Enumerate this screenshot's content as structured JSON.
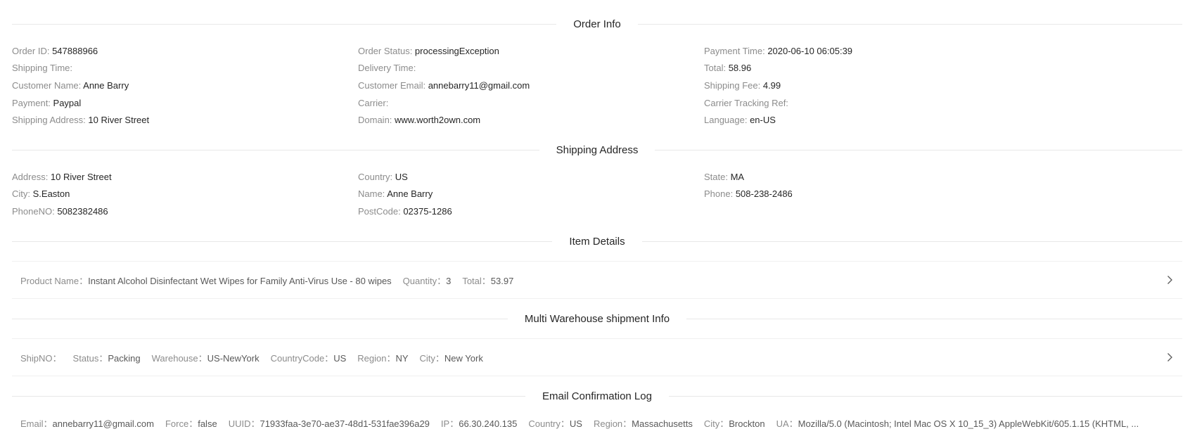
{
  "sections": {
    "order_info": "Order Info",
    "shipping_address": "Shipping Address",
    "item_details": "Item Details",
    "multi_warehouse": "Multi Warehouse shipment Info",
    "email_log": "Email Confirmation Log"
  },
  "order_info": {
    "rows": [
      [
        {
          "label": "Order ID: ",
          "value": "547888966"
        },
        {
          "label": "Order Status: ",
          "value": "processingException"
        },
        {
          "label": "Payment Time: ",
          "value": "2020-06-10 06:05:39"
        }
      ],
      [
        {
          "label": "Shipping Time: ",
          "value": ""
        },
        {
          "label": "Delivery Time: ",
          "value": ""
        },
        {
          "label": "Total: ",
          "value": "58.96"
        }
      ],
      [
        {
          "label": "Customer Name: ",
          "value": "Anne Barry"
        },
        {
          "label": "Customer Email: ",
          "value": "annebarry11@gmail.com"
        },
        {
          "label": "Shipping Fee: ",
          "value": "4.99"
        }
      ],
      [
        {
          "label": "Payment: ",
          "value": "Paypal"
        },
        {
          "label": "Carrier: ",
          "value": ""
        },
        {
          "label": "Carrier Tracking Ref: ",
          "value": ""
        }
      ],
      [
        {
          "label": "Shipping Address: ",
          "value": "10 River Street"
        },
        {
          "label": "Domain: ",
          "value": "www.worth2own.com"
        },
        {
          "label": "Language: ",
          "value": "en-US"
        }
      ]
    ]
  },
  "shipping_address": {
    "rows": [
      [
        {
          "label": "Address: ",
          "value": "10 River Street"
        },
        {
          "label": "Country: ",
          "value": "US"
        },
        {
          "label": "State: ",
          "value": "MA"
        }
      ],
      [
        {
          "label": "City: ",
          "value": "S.Easton"
        },
        {
          "label": "Name: ",
          "value": "Anne Barry"
        },
        {
          "label": "Phone: ",
          "value": "508-238-2486"
        }
      ],
      [
        {
          "label": "PhoneNO: ",
          "value": "5082382486"
        },
        {
          "label": "PostCode: ",
          "value": "02375-1286"
        },
        {
          "label": "",
          "value": ""
        }
      ]
    ]
  },
  "item_details": {
    "product_name_label": "Product Name：",
    "product_name": "Instant Alcohol Disinfectant Wet Wipes for Family Anti-Virus Use - 80 wipes",
    "quantity_label": "Quantity：",
    "quantity": "3",
    "total_label": "Total：",
    "total": "53.97"
  },
  "multi_warehouse": {
    "shipno_label": "ShipNO：",
    "shipno": "",
    "status_label": "Status：",
    "status": "Packing",
    "warehouse_label": "Warehouse：",
    "warehouse": "US-NewYork",
    "countrycode_label": "CountryCode：",
    "countrycode": "US",
    "region_label": "Region：",
    "region": "NY",
    "city_label": "City：",
    "city": "New York"
  },
  "email_log": {
    "email_label": "Email：",
    "email": "annebarry11@gmail.com",
    "force_label": "Force：",
    "force": "false",
    "uuid_label": "UUID：",
    "uuid": "71933faa-3e70-ae37-48d1-531fae396a29",
    "ip_label": "IP：",
    "ip": "66.30.240.135",
    "country_label": "Country：",
    "country": "US",
    "region_label": "Region：",
    "region": "Massachusetts",
    "city_label": "City：",
    "city": "Brockton",
    "ua_label": "UA：",
    "ua": "Mozilla/5.0 (Macintosh; Intel Mac OS X 10_15_3) AppleWebKit/605.1.15 (KHTML, ..."
  },
  "icons": {
    "chevron": "chevron-right-icon"
  }
}
